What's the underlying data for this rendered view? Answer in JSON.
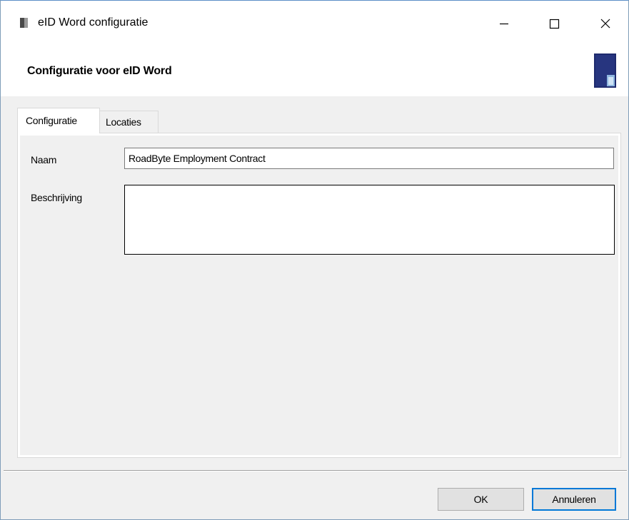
{
  "window": {
    "title": "eID Word configuratie",
    "icon": "document-icon"
  },
  "controls": {
    "minimize_icon": "minimize-icon",
    "maximize_icon": "maximize-icon",
    "close_icon": "close-icon"
  },
  "header": {
    "title": "Configuratie voor eID Word",
    "logo_icon": "eid-word-logo-icon"
  },
  "tabs": [
    {
      "label": "Configuratie",
      "selected": true
    },
    {
      "label": "Locaties",
      "selected": false
    }
  ],
  "form": {
    "naam_label": "Naam",
    "naam_value": "RoadByte Employment Contract",
    "beschrijving_label": "Beschrijving",
    "beschrijving_value": ""
  },
  "buttons": {
    "ok_label": "OK",
    "cancel_label": "Annuleren"
  },
  "colors": {
    "accent": "#0078d7",
    "logo": "#1e2a6e"
  }
}
